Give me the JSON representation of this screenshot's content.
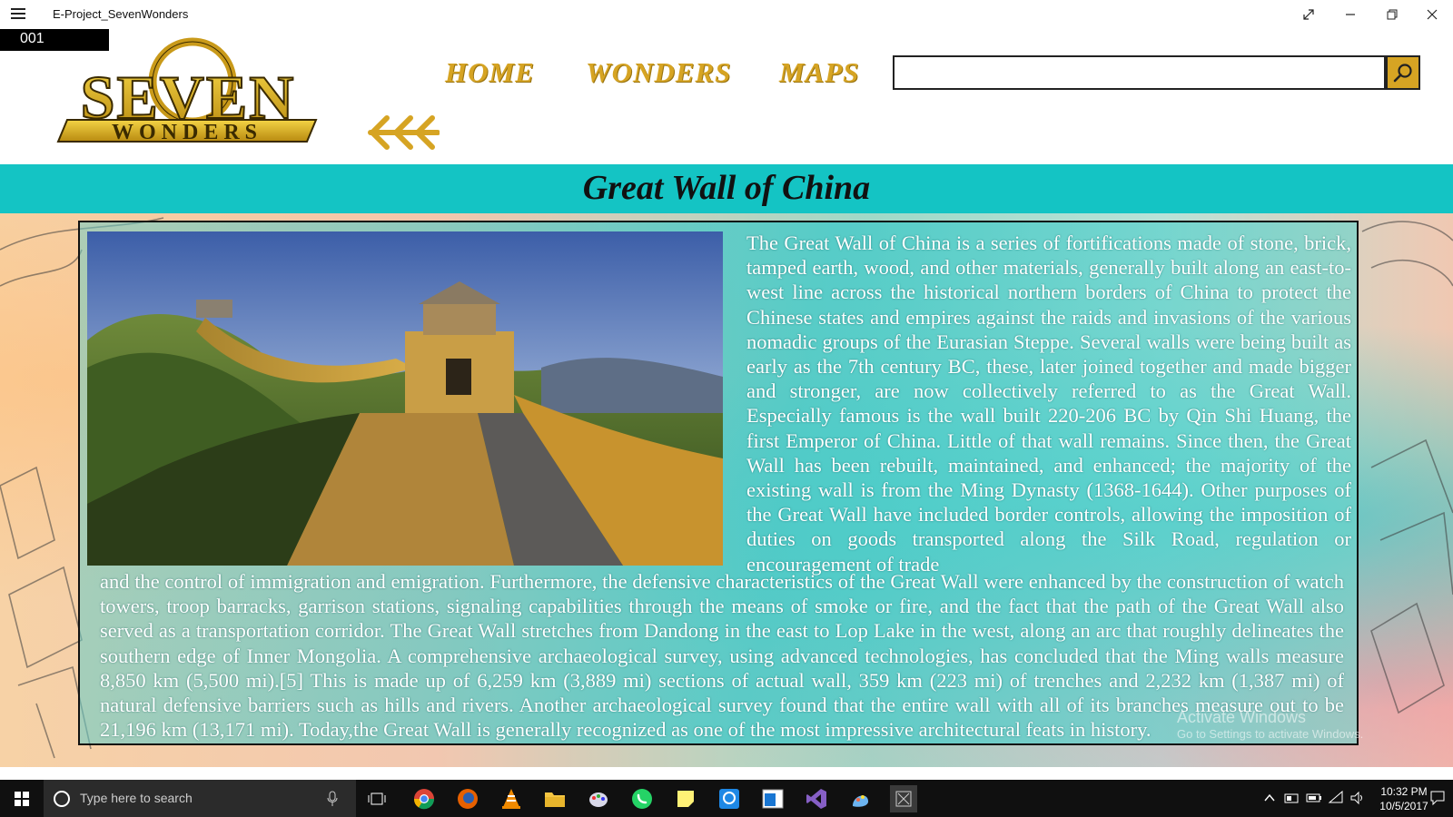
{
  "window": {
    "title": "E-Project_SevenWonders",
    "counter": "001"
  },
  "logo": {
    "line1": "SEVEN",
    "line2": "WONDERS"
  },
  "nav": {
    "home": "HOME",
    "wonders": "WONDERS",
    "maps": "MAPS"
  },
  "search": {
    "value": ""
  },
  "page": {
    "title": "Great Wall of China",
    "paragraph_top": "The Great Wall of China is a series of fortifications made of stone, brick, tamped earth, wood, and other materials, generally built along an east-to-west line across the historical northern borders of China to protect the Chinese states and empires against the raids and invasions of the various nomadic groups of the Eurasian Steppe. Several walls were being built as early as the 7th century BC, these, later joined together and made bigger and stronger, are now collectively referred to as the Great Wall. Especially famous is the wall built 220-206 BC by Qin Shi Huang, the first Emperor of China. Little of that wall remains. Since then, the Great Wall has been rebuilt, maintained, and enhanced; the majority of the existing wall is from the Ming Dynasty (1368-1644). Other purposes of the Great Wall have included border controls, allowing the imposition of duties on goods transported along the Silk Road, regulation or encouragement of trade",
    "paragraph_bottom": "and the control of immigration and emigration. Furthermore, the defensive characteristics of the Great Wall were enhanced by the construction of watch towers, troop barracks, garrison stations, signaling capabilities through the means of smoke or fire, and the fact that the path of the Great Wall also served as a transportation corridor. The Great Wall stretches from Dandong in the east to Lop Lake in the west, along an arc that roughly delineates the southern edge of Inner Mongolia. A comprehensive archaeological survey, using advanced technologies, has concluded that the Ming walls measure 8,850 km (5,500 mi).[5] This is made up of 6,259 km (3,889 mi) sections of actual wall, 359 km (223 mi) of trenches and 2,232 km (1,387 mi) of natural defensive barriers such as hills and rivers. Another archaeological survey found that the entire wall with all of its branches measure out to be 21,196 km (13,171 mi). Today,the Great Wall is generally recognized as one of the most impressive architectural feats in history."
  },
  "watermark": {
    "line1": "Activate Windows",
    "line2": "Go to Settings to activate Windows."
  },
  "taskbar": {
    "search_placeholder": "Type here to search",
    "time": "10:32 PM",
    "date": "10/5/2017"
  },
  "colors": {
    "accent_gold": "#d6a423",
    "title_band": "#14c4c4"
  }
}
